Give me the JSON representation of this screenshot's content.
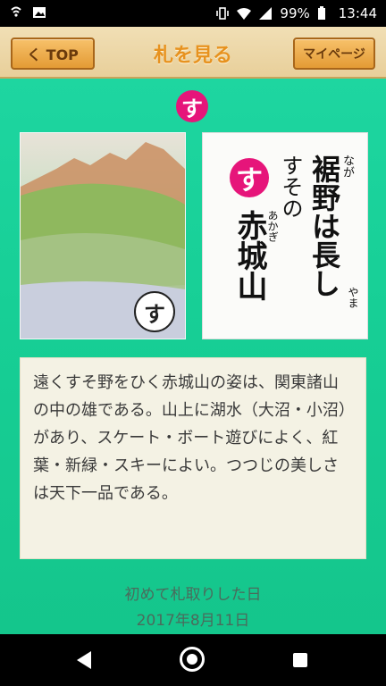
{
  "status_bar": {
    "battery": "99%",
    "time": "13:44",
    "icons": [
      "wifi-calling-icon",
      "image-icon",
      "vibrate-icon",
      "wifi-icon",
      "signal-icon",
      "battery-icon"
    ]
  },
  "header": {
    "back_label": "く TOP",
    "title": "札を見る",
    "mypage_label": "マイページ"
  },
  "card": {
    "letter": "す",
    "poem_col1": "すその",
    "poem_col2": "裾野は長し",
    "poem_col3": "なが",
    "poem_col4": "赤城山",
    "ruby_1": "あかぎ",
    "ruby_2": "やま"
  },
  "description": "遠くすそ野をひく赤城山の姿は、関東諸山の中の雄である。山上に湖水（大沼・小沼）があり、スケート・ボート遊びによく、紅葉・新緑・スキーによい。つつじの美しさは天下一品である。",
  "first_taken": {
    "label": "初めて札取りした日",
    "date": "2017年8月11日"
  },
  "colors": {
    "accent": "#e6157a",
    "background": "#17cf96",
    "header": "#e8cf9a",
    "title": "#e7921f"
  }
}
